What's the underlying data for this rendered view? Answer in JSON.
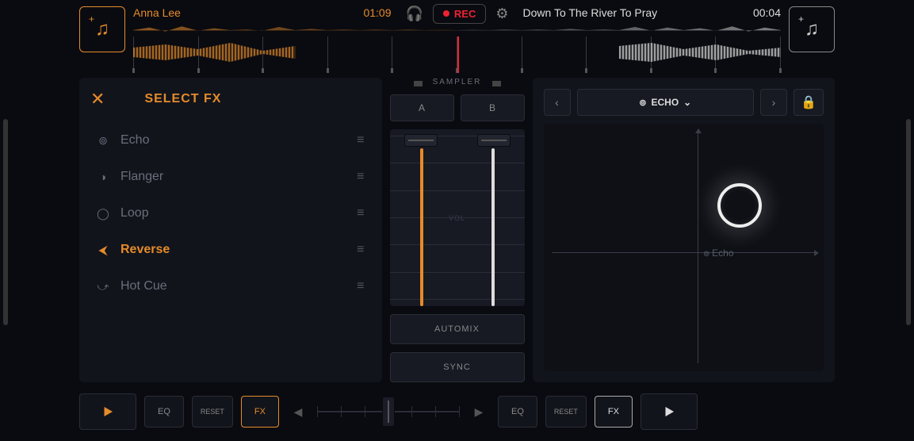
{
  "header": {
    "deck_left": {
      "track_name": "Anna Lee",
      "time": "01:09"
    },
    "deck_right": {
      "track_name": "Down To The River To Pray",
      "time": "00:04"
    },
    "rec_label": "REC"
  },
  "fx_panel": {
    "title": "SELECT FX",
    "items": [
      {
        "icon": "⊚",
        "label": "Echo",
        "active": false
      },
      {
        "icon": "◑",
        "label": "Flanger",
        "active": false
      },
      {
        "icon": "◯",
        "label": "Loop",
        "active": false
      },
      {
        "icon": "⮜",
        "label": "Reverse",
        "active": true
      },
      {
        "icon": "⤻",
        "label": "Hot Cue",
        "active": false
      }
    ]
  },
  "sampler": {
    "label": "SAMPLER",
    "a": "A",
    "b": "B",
    "vol_label": "VOL",
    "automix": "AUTOMIX",
    "sync": "SYNC"
  },
  "xy": {
    "effect_name": "ECHO",
    "pad_label": "Echo"
  },
  "bottom": {
    "eq": "EQ",
    "reset": "RESET",
    "fx": "FX"
  }
}
